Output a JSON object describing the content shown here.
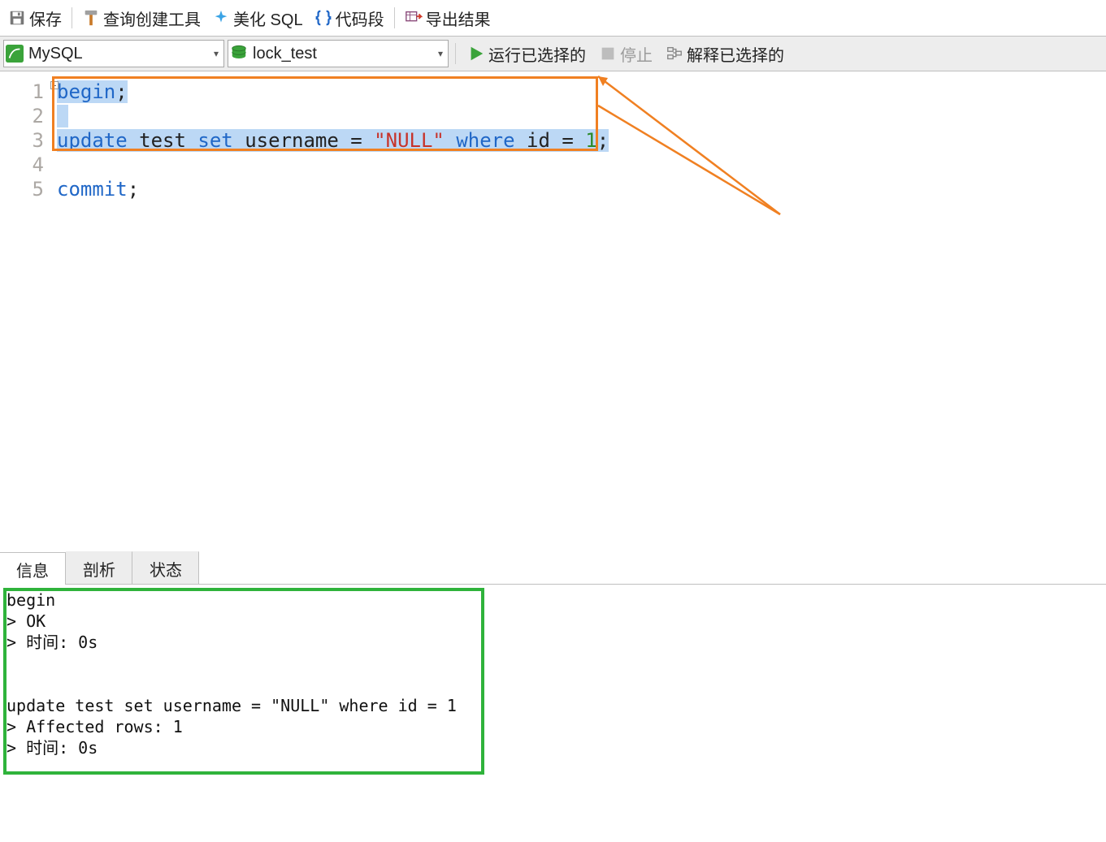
{
  "toolbar": {
    "save": "保存",
    "query_builder": "查询创建工具",
    "beautify": "美化 SQL",
    "snippets": "代码段",
    "export": "导出结果"
  },
  "action_bar": {
    "engine": "MySQL",
    "schema": "lock_test",
    "run_selected": "运行已选择的",
    "stop": "停止",
    "explain_selected": "解释已选择的"
  },
  "editor": {
    "line_count": 5,
    "lines": {
      "l1": {
        "kw": "begin",
        "punct": ";"
      },
      "l3": {
        "kw1": "update",
        "ident1": " test ",
        "kw2": "set",
        "ident2": " username ",
        "eq": "= ",
        "str": "\"NULL\"",
        "sp": " ",
        "kw3": "where",
        "ident3": " id ",
        "eq2": "= ",
        "num": "1",
        "punct": ";"
      },
      "l5": {
        "kw": "commit",
        "punct": ";"
      }
    }
  },
  "tabs": {
    "info": "信息",
    "profiler": "剖析",
    "status": "状态"
  },
  "output_text": "begin\n> OK\n> 时间: 0s\n\n\nupdate test set username = \"NULL\" where id = 1\n> Affected rows: 1\n> 时间: 0s"
}
